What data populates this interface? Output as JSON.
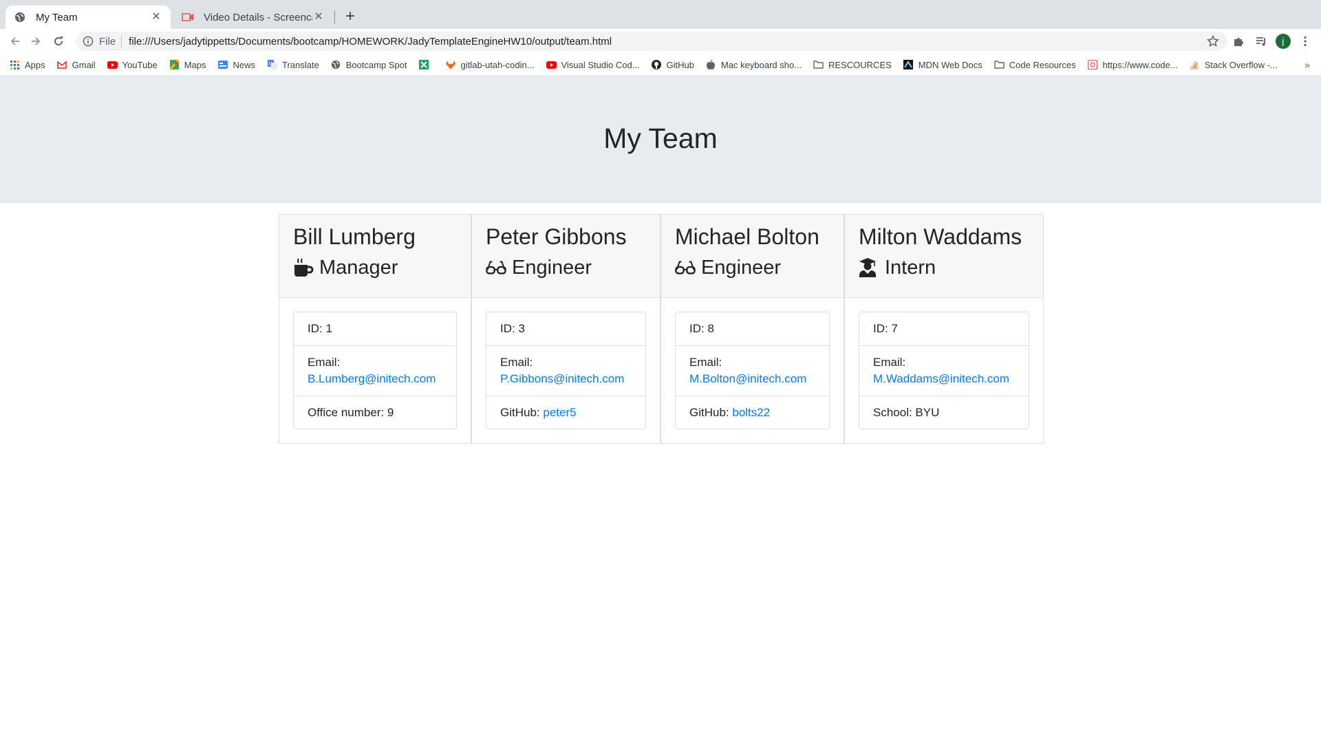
{
  "browser": {
    "tabs": [
      {
        "title": "My Team",
        "icon": "globe-icon",
        "active": true
      },
      {
        "title": "Video Details - Screencastify",
        "icon": "screencastify-icon",
        "active": false
      }
    ],
    "url_scheme": "File",
    "url": "file:///Users/jadytippetts/Documents/bootcamp/HOMEWORK/JadyTemplateEngineHW10/output/team.html",
    "profile_initial": "j",
    "bookmarks": [
      {
        "label": "Apps",
        "icon": "apps-grid-icon"
      },
      {
        "label": "Gmail",
        "icon": "gmail-icon"
      },
      {
        "label": "YouTube",
        "icon": "youtube-icon"
      },
      {
        "label": "Maps",
        "icon": "maps-icon"
      },
      {
        "label": "News",
        "icon": "news-icon"
      },
      {
        "label": "Translate",
        "icon": "translate-icon"
      },
      {
        "label": "Bootcamp Spot",
        "icon": "globe-icon"
      },
      {
        "label": "",
        "icon": "spreadsheet-icon"
      },
      {
        "label": "gitlab-utah-codin...",
        "icon": "gitlab-icon"
      },
      {
        "label": "Visual Studio Cod...",
        "icon": "youtube-icon"
      },
      {
        "label": "GitHub",
        "icon": "github-icon"
      },
      {
        "label": "Mac keyboard sho...",
        "icon": "apple-icon"
      },
      {
        "label": "RESCOURCES",
        "icon": "folder-icon"
      },
      {
        "label": "MDN Web Docs",
        "icon": "mdn-icon"
      },
      {
        "label": "Code Resources",
        "icon": "folder-icon"
      },
      {
        "label": "https://www.code...",
        "icon": "codecademy-icon"
      },
      {
        "label": "Stack Overflow -...",
        "icon": "stackoverflow-icon"
      }
    ]
  },
  "page": {
    "title": "My Team",
    "team": [
      {
        "name": "Bill Lumberg",
        "role": "Manager",
        "role_icon": "mug-icon",
        "id_text": "ID: 1",
        "email_label": "Email:",
        "email": "B.Lumberg@initech.com",
        "extra_label": "Office number: 9",
        "extra_link": ""
      },
      {
        "name": "Peter Gibbons",
        "role": "Engineer",
        "role_icon": "glasses-icon",
        "id_text": "ID: 3",
        "email_label": "Email:",
        "email": "P.Gibbons@initech.com",
        "extra_label": "GitHub: ",
        "extra_link": "peter5"
      },
      {
        "name": "Michael Bolton",
        "role": "Engineer",
        "role_icon": "glasses-icon",
        "id_text": "ID: 8",
        "email_label": "Email:",
        "email": "M.Bolton@initech.com",
        "extra_label": "GitHub: ",
        "extra_link": "bolts22"
      },
      {
        "name": "Milton Waddams",
        "role": "Intern",
        "role_icon": "graduate-icon",
        "id_text": "ID: 7",
        "email_label": "Email:",
        "email": "M.Waddams@initech.com",
        "extra_label": "School: BYU",
        "extra_link": ""
      }
    ]
  }
}
